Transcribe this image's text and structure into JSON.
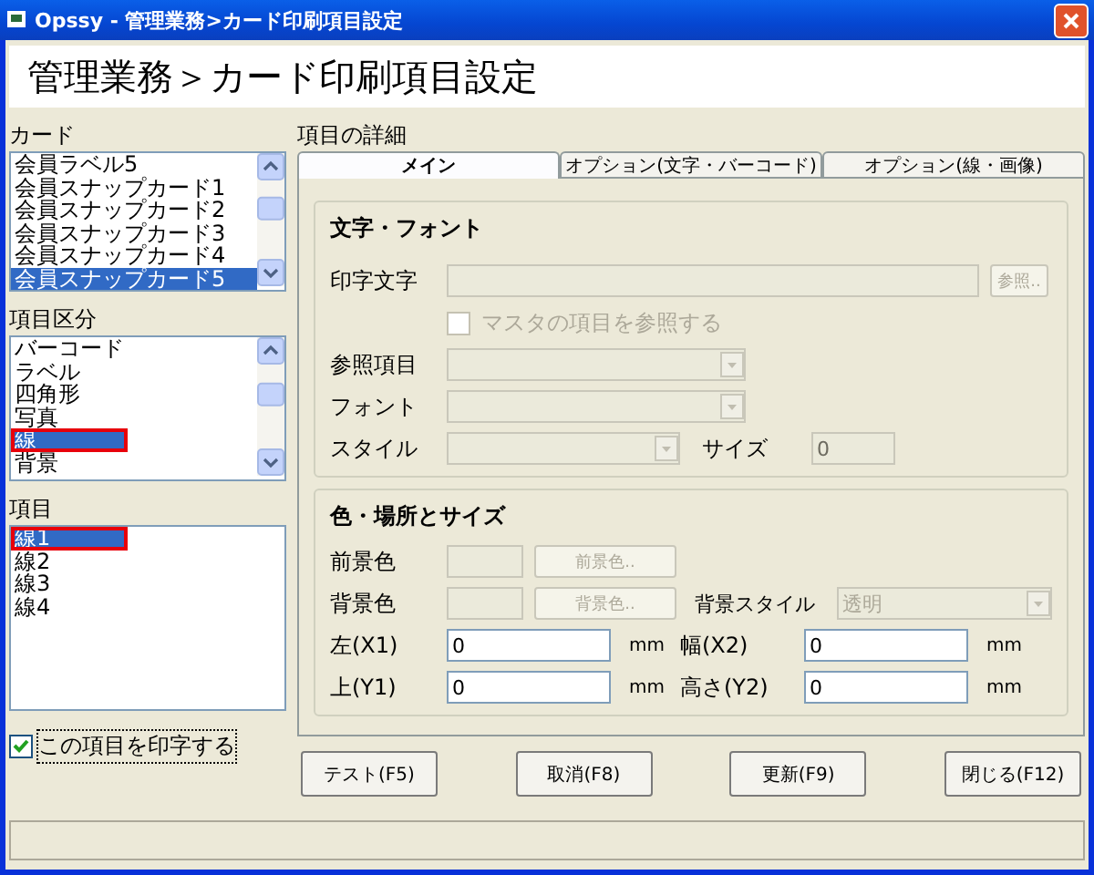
{
  "window": {
    "title": "Opssy - 管理業務>カード印刷項目設定"
  },
  "header": "管理業務＞カード印刷項目設定",
  "lists": [
    {
      "label": "カード",
      "items": [
        {
          "text": "会員ラベル5",
          "selected": false,
          "annotated": false
        },
        {
          "text": "会員スナップカード1",
          "selected": false,
          "annotated": false
        },
        {
          "text": "会員スナップカード2",
          "selected": false,
          "annotated": false
        },
        {
          "text": "会員スナップカード3",
          "selected": false,
          "annotated": false
        },
        {
          "text": "会員スナップカード4",
          "selected": false,
          "annotated": false
        },
        {
          "text": "会員スナップカード5",
          "selected": true,
          "annotated": false
        }
      ]
    },
    {
      "label": "項目区分",
      "items": [
        {
          "text": "バーコード",
          "selected": false,
          "annotated": false
        },
        {
          "text": "ラベル",
          "selected": false,
          "annotated": false
        },
        {
          "text": "四角形",
          "selected": false,
          "annotated": false
        },
        {
          "text": "写真",
          "selected": false,
          "annotated": false
        },
        {
          "text": "線",
          "selected": true,
          "annotated": true
        },
        {
          "text": "背景",
          "selected": false,
          "annotated": false
        }
      ]
    },
    {
      "label": "項目",
      "items": [
        {
          "text": "線1",
          "selected": true,
          "annotated": true
        },
        {
          "text": "線2",
          "selected": false,
          "annotated": false
        },
        {
          "text": "線3",
          "selected": false,
          "annotated": false
        },
        {
          "text": "線4",
          "selected": false,
          "annotated": false
        }
      ]
    }
  ],
  "print_item": {
    "label": "この項目を印字する",
    "checked": true
  },
  "details": {
    "label": "項目の詳細",
    "tabs": [
      {
        "label": "メイン",
        "selected": true
      },
      {
        "label": "オプション(文字・バーコード)",
        "selected": false
      },
      {
        "label": "オプション(線・画像)",
        "selected": false
      }
    ],
    "font_group": {
      "title": "文字・フォント",
      "print_text": {
        "label": "印字文字",
        "disabled": true,
        "button": "参照.."
      },
      "master_ref": {
        "label": "マスタの項目を参照する",
        "checked": false,
        "disabled": true
      },
      "ref_item": {
        "label": "参照項目",
        "disabled": true
      },
      "font": {
        "label": "フォント",
        "disabled": true
      },
      "style": {
        "label": "スタイル",
        "disabled": true
      },
      "size": {
        "label": "サイズ",
        "value": "0",
        "disabled": true
      }
    },
    "layout_group": {
      "title": "色・場所とサイズ",
      "fg": {
        "label": "前景色",
        "button": "前景色..",
        "disabled": true
      },
      "bg": {
        "label": "背景色",
        "button": "背景色..",
        "disabled": true
      },
      "bg_style": {
        "label": "背景スタイル",
        "value": "透明",
        "disabled": true
      },
      "positions": [
        {
          "label": "左(X1)",
          "value": "0",
          "unit": "mm"
        },
        {
          "label": "幅(X2)",
          "value": "0",
          "unit": "mm"
        },
        {
          "label": "上(Y1)",
          "value": "0",
          "unit": "mm"
        },
        {
          "label": "高さ(Y2)",
          "value": "0",
          "unit": "mm"
        }
      ]
    }
  },
  "buttons": [
    "テスト(F5)",
    "取消(F8)",
    "更新(F9)",
    "閉じる(F12)"
  ]
}
